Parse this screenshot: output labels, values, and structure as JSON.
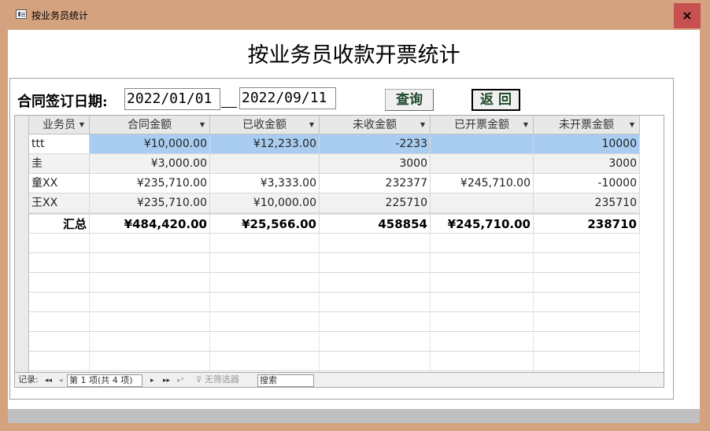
{
  "window": {
    "title": "按业务员统计",
    "close_label": "×"
  },
  "form": {
    "title": "按业务员收款开票统计",
    "date_label": "合同签订日期:",
    "date_from": "2022/01/01",
    "date_to": "2022/09/11",
    "query_button": "查询",
    "back_button": "返 回"
  },
  "table": {
    "columns": [
      "业务员",
      "合同金额",
      "已收金额",
      "未收金额",
      "已开票金额",
      "未开票金额"
    ],
    "rows": [
      [
        "ttt",
        "¥10,000.00",
        "¥12,233.00",
        "-2233",
        "",
        "10000"
      ],
      [
        "圭",
        "¥3,000.00",
        "",
        "3000",
        "",
        "3000"
      ],
      [
        "童XX",
        "¥235,710.00",
        "¥3,333.00",
        "232377",
        "¥245,710.00",
        "-10000"
      ],
      [
        "王XX",
        "¥235,710.00",
        "¥10,000.00",
        "225710",
        "",
        "235710"
      ]
    ],
    "summary": [
      "汇总",
      "¥484,420.00",
      "¥25,566.00",
      "458854",
      "¥245,710.00",
      "238710"
    ]
  },
  "navigator": {
    "record_label": "记录:",
    "first": "◂◂",
    "prev": "◂",
    "position": "第 1 项(共 4 项)",
    "next": "▸",
    "last": "▸▸",
    "new": "▸*",
    "filter": "无筛选器",
    "search": "搜索"
  },
  "colors": {
    "titlebar": "#d4a27f",
    "close": "#c75050",
    "selection": "#a9cdf0",
    "button_text": "#1e4a2a"
  }
}
